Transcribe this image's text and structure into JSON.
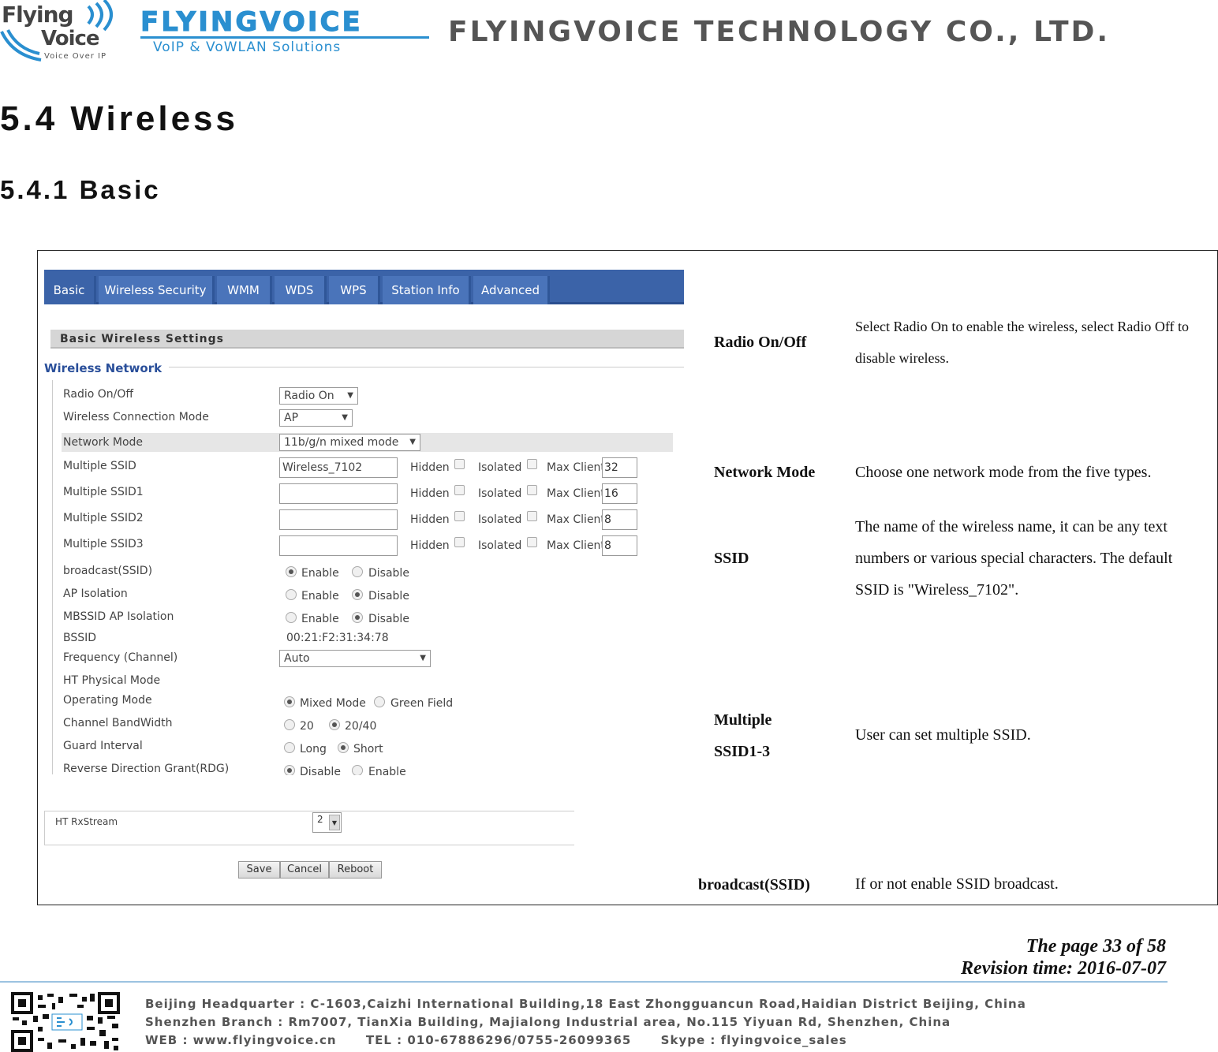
{
  "header": {
    "logo_flying": "Flying",
    "logo_voice": "Voice",
    "logo_tagline": "Voice Over IP",
    "brand": "FLYINGVOICE",
    "brand_sub": "VoIP & VoWLAN Solutions",
    "company": "FLYINGVOICE TECHNOLOGY CO., LTD."
  },
  "section_title": "5.4  Wireless",
  "subsection_title": "5.4.1 Basic",
  "screenshot": {
    "tabs": [
      "Basic",
      "Wireless Security",
      "WMM",
      "WDS",
      "WPS",
      "Station Info",
      "Advanced"
    ],
    "section_header": "Basic Wireless Settings",
    "group_title": "Wireless Network",
    "labels": {
      "radio": "Radio On/Off",
      "conn_mode": "Wireless Connection Mode",
      "net_mode": "Network Mode",
      "ssid": "Multiple SSID",
      "ssid1": "Multiple SSID1",
      "ssid2": "Multiple SSID2",
      "ssid3": "Multiple SSID3",
      "broadcast": "broadcast(SSID)",
      "ap_iso": "AP Isolation",
      "mbssid": "MBSSID AP Isolation",
      "bssid": "BSSID",
      "freq": "Frequency (Channel)",
      "ht_phys": "HT Physical Mode",
      "op_mode": "Operating Mode",
      "bandwidth": "Channel BandWidth",
      "guard": "Guard Interval",
      "rdg": "Reverse Direction Grant(RDG)",
      "ht_rx": "HT RxStream"
    },
    "values": {
      "radio": "Radio On",
      "conn_mode": "AP",
      "net_mode": "11b/g/n mixed mode",
      "ssid": "Wireless_7102",
      "ssid1": "",
      "ssid2": "",
      "ssid3": "",
      "bssid": "00:21:F2:31:34:78",
      "freq": "Auto",
      "ht_rx": "2"
    },
    "hidden_label": "Hidden",
    "isolated_label": "Isolated",
    "max_client_label": "Max Client",
    "max_clients": [
      "32",
      "16",
      "8",
      "8"
    ],
    "opt_enable": "Enable",
    "opt_disable": "Disable",
    "opt_mixed": "Mixed Mode",
    "opt_green": "Green Field",
    "opt_20": "20",
    "opt_2040": "20/40",
    "opt_long": "Long",
    "opt_short": "Short",
    "opt_disable_rdg": "Disable",
    "opt_enable_rdg": "Enable",
    "buttons": {
      "save": "Save",
      "cancel": "Cancel",
      "reboot": "Reboot"
    }
  },
  "descriptions": [
    {
      "term": "Radio On/Off",
      "text": "Select Radio On to enable the wireless, select Radio Off to disable wireless."
    },
    {
      "term": "Network Mode",
      "text": "Choose one network mode from the five types."
    },
    {
      "term": "SSID",
      "text": "The name of the wireless name, it can be any text numbers or various special characters. The default SSID is \"Wireless_7102\"."
    },
    {
      "term_line1": "Multiple",
      "term_line2": "SSID1-3",
      "text": "User can set multiple SSID."
    },
    {
      "term": "broadcast(SSID)",
      "text": "If or not enable SSID broadcast."
    }
  ],
  "footer": {
    "page": "The page 33 of 58",
    "revision": "Revision time: 2016-07-07",
    "hq": "Beijing Headquarter   : C-1603,Caizhi International Building,18 East Zhongguancun Road,Haidian District Beijing, China",
    "branch": "Shenzhen Branch : Rm7007, TianXia Building, Majialong Industrial area, No.115 Yiyuan Rd, Shenzhen, China",
    "web": "WEB : www.flyingvoice.cn      TEL : 010-67886296/0755-26099365      Skype : flyingvoice_sales"
  }
}
